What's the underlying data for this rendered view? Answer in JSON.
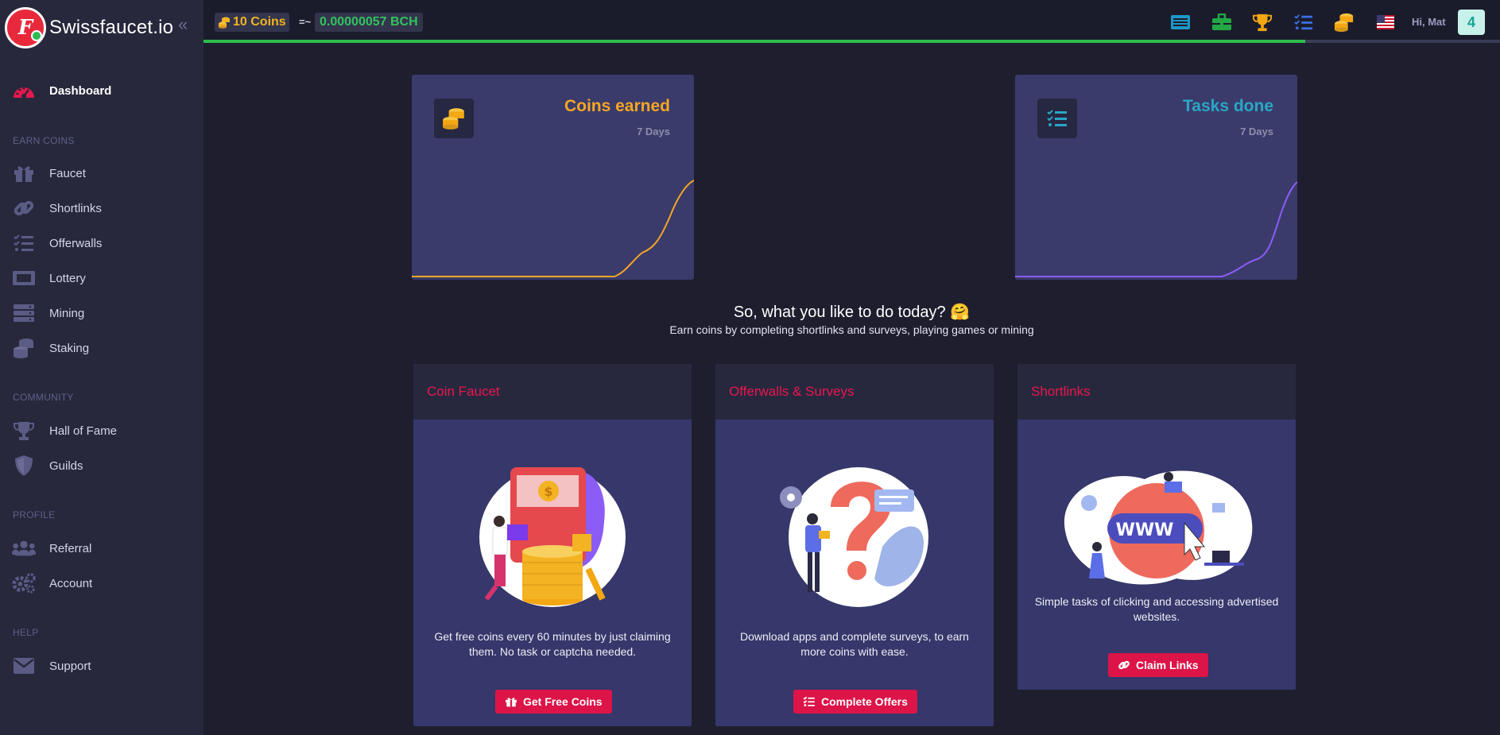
{
  "brand": {
    "name": "Swissfaucet.io",
    "logo_letter": "F"
  },
  "sidebar": {
    "dashboard": "Dashboard",
    "sections": {
      "earn": "EARN COINS",
      "community": "COMMUNITY",
      "profile": "PROFILE",
      "help": "HELP"
    },
    "earn_items": [
      "Faucet",
      "Shortlinks",
      "Offerwalls",
      "Lottery",
      "Mining",
      "Staking"
    ],
    "community_items": [
      "Hall of Fame",
      "Guilds"
    ],
    "profile_items": [
      "Referral",
      "Account"
    ],
    "help_items": [
      "Support"
    ]
  },
  "topbar": {
    "coins": "10 Coins",
    "approx": "=~",
    "bch": "0.00000057 BCH",
    "greeting": "Hi, Mat",
    "notifications": "4",
    "progress": 0.85,
    "icons": [
      "list-icon",
      "briefcase-icon",
      "trophy-icon",
      "tasks-icon",
      "coins-icon",
      "us-flag-icon"
    ]
  },
  "stats": {
    "coins": {
      "title": "Coins earned",
      "period": "7 Days",
      "color": "#f5a623"
    },
    "tasks": {
      "title": "Tasks done",
      "period": "7 Days",
      "color": "#2aa6c6",
      "line_color": "#8b5cf6"
    }
  },
  "headline": {
    "title": "So, what you like to do today? 🤗",
    "subtitle": "Earn coins by completing shortlinks and surveys, playing games or mining"
  },
  "tasks": [
    {
      "title": "Coin Faucet",
      "text": "Get free coins every 60 minutes by just claiming them. No task or captcha needed.",
      "button": "Get Free Coins"
    },
    {
      "title": "Offerwalls & Surveys",
      "text": "Download apps and complete surveys, to earn more coins with ease.",
      "button": "Complete Offers"
    },
    {
      "title": "Shortlinks",
      "text": "Simple tasks of clicking and accessing advertised websites.",
      "button": "Claim Links"
    }
  ],
  "illustration": {
    "www": "WWW"
  },
  "colors": {
    "accent": "#dc1448",
    "sidebar": "#27283c",
    "card": "#3a3b6b"
  }
}
